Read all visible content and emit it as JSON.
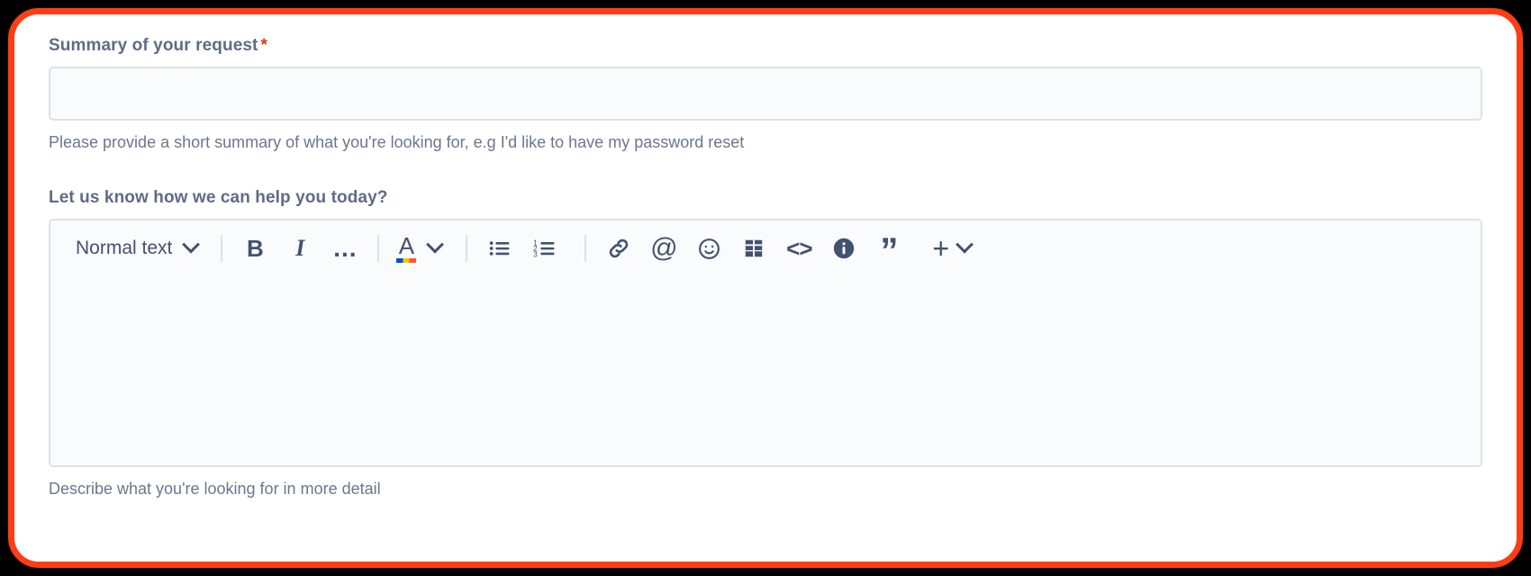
{
  "highlight": {
    "border_color": "#FF3D14",
    "background_color": "#000000"
  },
  "form": {
    "summary_field": {
      "label": "Summary of your request",
      "required_marker": "*",
      "value": "",
      "placeholder": "",
      "help_text": "Please provide a short summary of what you're looking for, e.g I'd like to have my password reset"
    },
    "description_field": {
      "label": "Let us know how we can help you today?",
      "value": "",
      "placeholder": "",
      "help_text": "Describe what you're looking for in more detail"
    }
  },
  "editor_toolbar": {
    "block_type": {
      "label": "Normal text",
      "icon": "chevron-down-icon"
    },
    "buttons": [
      {
        "name": "bold",
        "label": "B",
        "icon": "bold-icon"
      },
      {
        "name": "italic",
        "label": "I",
        "icon": "italic-icon"
      },
      {
        "name": "more-formatting",
        "label": "...",
        "icon": "ellipsis-icon"
      },
      {
        "name": "text-color",
        "label": "A",
        "icon": "text-color-icon"
      },
      {
        "name": "bullet-list",
        "label": "",
        "icon": "bullet-list-icon"
      },
      {
        "name": "numbered-list",
        "label": "",
        "icon": "numbered-list-icon"
      },
      {
        "name": "link",
        "label": "",
        "icon": "link-icon"
      },
      {
        "name": "mention",
        "label": "@",
        "icon": "mention-icon"
      },
      {
        "name": "emoji",
        "label": "",
        "icon": "emoji-icon"
      },
      {
        "name": "table",
        "label": "",
        "icon": "table-icon"
      },
      {
        "name": "code",
        "label": "<>",
        "icon": "code-icon"
      },
      {
        "name": "info-panel",
        "label": "",
        "icon": "info-panel-icon"
      },
      {
        "name": "quote",
        "label": "",
        "icon": "quote-icon"
      },
      {
        "name": "insert-more",
        "label": "+",
        "icon": "plus-icon"
      }
    ],
    "text_color_swatch": [
      "#0052CC",
      "#FFC400",
      "#FF5630"
    ]
  },
  "colors": {
    "label_text": "#5E6C84",
    "help_text": "#6B778C",
    "required_star": "#DE350B",
    "input_background": "#FAFBFC",
    "input_border": "#DFE1E6",
    "icon": "#42526E"
  }
}
